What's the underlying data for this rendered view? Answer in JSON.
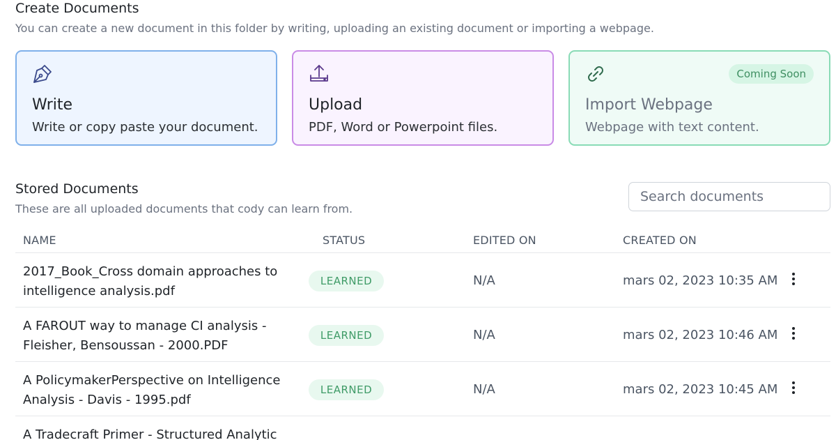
{
  "create": {
    "title": "Create Documents",
    "subtitle": "You can create a new document in this folder by writing, uploading an existing document or importing a webpage.",
    "cards": [
      {
        "icon": "pen-nib-icon",
        "title": "Write",
        "description": "Write or copy paste your document.",
        "accent": "#7fb0ea"
      },
      {
        "icon": "upload-icon",
        "title": "Upload",
        "description": "PDF, Word or Powerpoint files.",
        "accent": "#c98be6"
      },
      {
        "icon": "link-icon",
        "title": "Import Webpage",
        "description": "Webpage with text content.",
        "badge": "Coming Soon",
        "accent": "#89dbb6"
      }
    ]
  },
  "stored": {
    "title": "Stored Documents",
    "subtitle": "These are all uploaded documents that cody can learn from.",
    "search_placeholder": "Search documents"
  },
  "table": {
    "columns": {
      "name": "NAME",
      "status": "STATUS",
      "edited": "EDITED ON",
      "created": "CREATED ON"
    },
    "rows": [
      {
        "name": "2017_Book_Cross domain approaches to intelligence analysis.pdf",
        "status": "LEARNED",
        "edited": "N/A",
        "created": "mars 02, 2023 10:35 AM"
      },
      {
        "name": "A FAROUT way to manage CI analysis - Fleisher, Bensoussan - 2000.PDF",
        "status": "LEARNED",
        "edited": "N/A",
        "created": "mars 02, 2023 10:46 AM"
      },
      {
        "name": "A PolicymakerPerspective on Intelligence Analysis - Davis - 1995.pdf",
        "status": "LEARNED",
        "edited": "N/A",
        "created": "mars 02, 2023 10:45 AM"
      },
      {
        "name": "A Tradecraft Primer - Structured Analytic",
        "status": "",
        "edited": "",
        "created": ""
      }
    ]
  },
  "colors": {
    "status_learned_bg": "#e8f8ef",
    "status_learned_text": "#3f9b67",
    "badge_bg": "#d6f5e5"
  }
}
